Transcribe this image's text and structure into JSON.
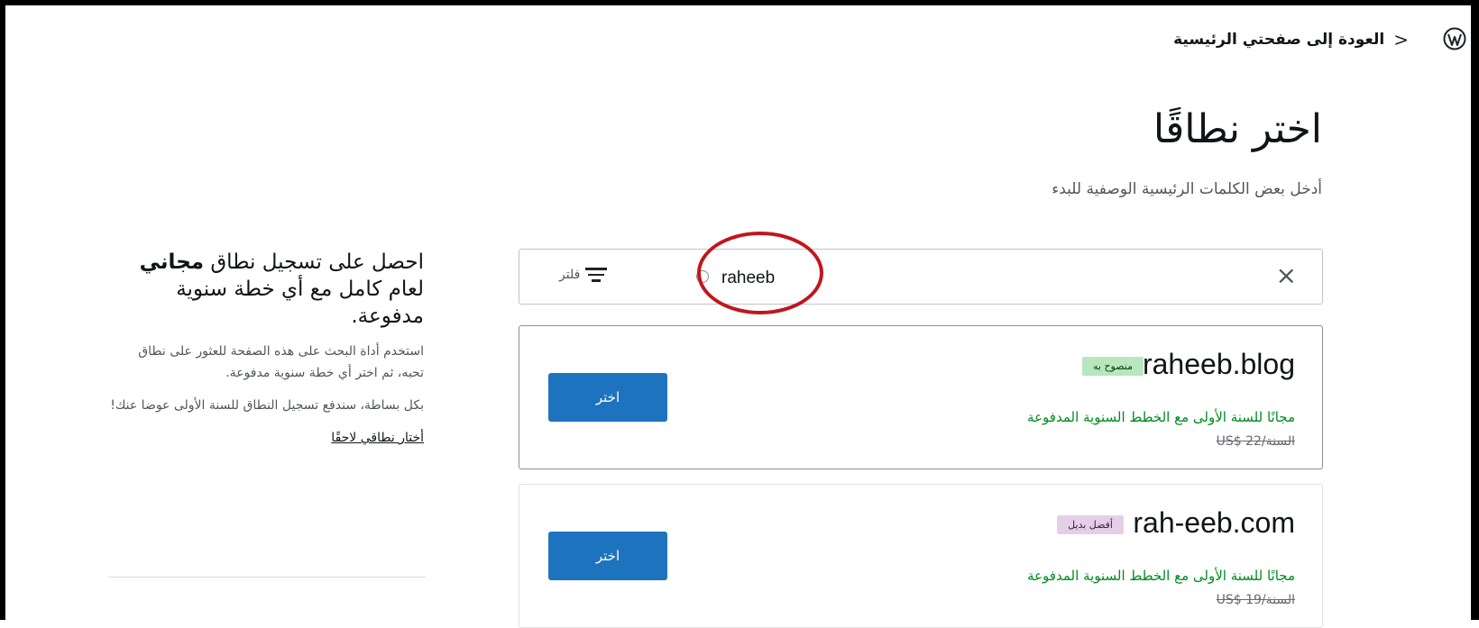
{
  "header": {
    "back_label": "العودة إلى صفحتي الرئيسية",
    "back_chevron": "<",
    "logo_icon": "wordpress-icon"
  },
  "main": {
    "title": "اختر نطاقًا",
    "subtitle": "أدخل بعض الكلمات الرئيسية الوصفية للبدء"
  },
  "search": {
    "value": "raheeb",
    "clear_icon": "×",
    "filter_label": "فلتر"
  },
  "results": [
    {
      "domain": "raheeb.blog",
      "badge": "منصوح به",
      "price_free": "مجانًا للسنة الأولى مع الخطط السنوية المدفوعة",
      "price_original": "US$ 22/السنة",
      "button": "اختر"
    },
    {
      "domain": "rah-eeb.com",
      "badge": "أفضل بديل",
      "price_free": "مجانًا للسنة الأولى مع الخطط السنوية المدفوعة",
      "price_original": "US$ 19/السنة",
      "button": "اختر"
    }
  ],
  "sidebar": {
    "heading_part1": "احصل على تسجيل نطاق",
    "heading_bold": "مجاني",
    "heading_part2": "لعام كامل مع أي خطة سنوية مدفوعة.",
    "paragraph1": "استخدم أداة البحث على هذه الصفحة للعثور على نطاق تحبه، ثم اختر أي خطة سنوية مدفوعة.",
    "paragraph2": "بكل بساطة، سندفع تسجيل النطاق للسنة الأولى عوضا عنك!",
    "link": "أختار نطاقي لاحقًا"
  },
  "colors": {
    "accent": "#1e73be",
    "success": "#008a20",
    "annotation": "#c0161d"
  }
}
